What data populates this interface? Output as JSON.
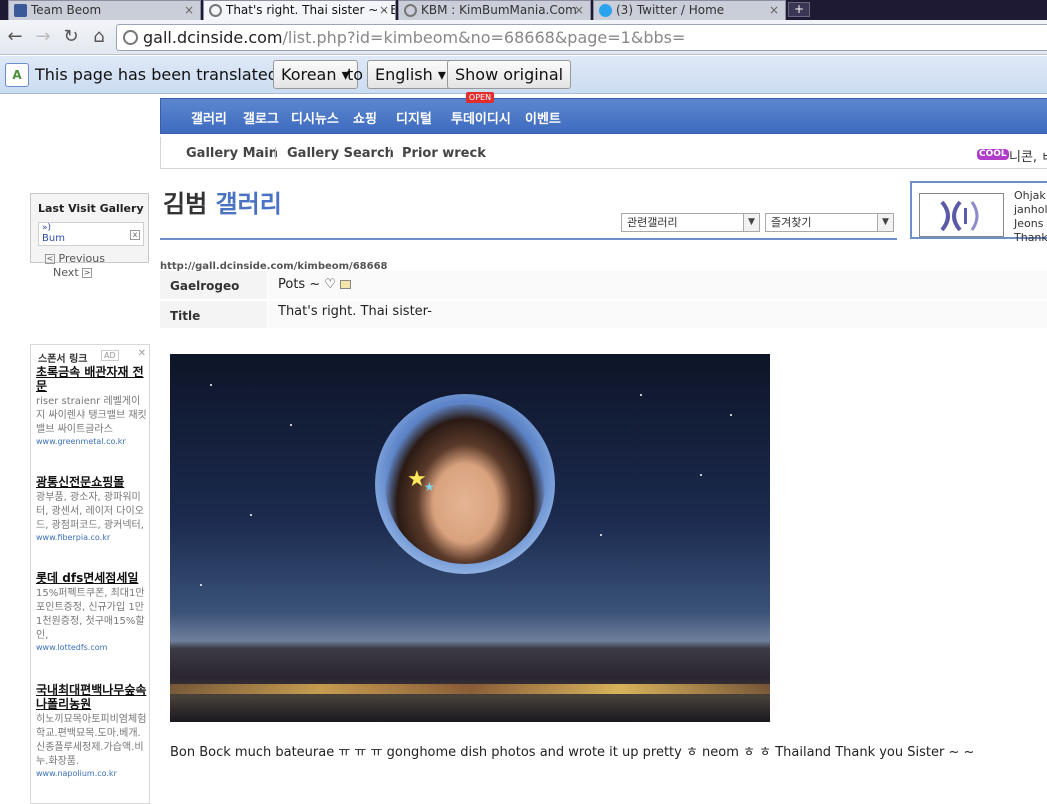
{
  "browser": {
    "tabs": [
      {
        "title": "Team Beom",
        "icon": "facebook-icon",
        "color": "#3b5998"
      },
      {
        "title": "That's right. Thai sister ~ - E",
        "icon": "globe-icon",
        "color": "#7a7a7a"
      },
      {
        "title": "KBM : KimBumMania.Com",
        "icon": "globe-icon",
        "color": "#7a7a7a"
      },
      {
        "title": "(3) Twitter / Home",
        "icon": "twitter-icon",
        "color": "#2aa3ef"
      }
    ],
    "new_tab": "+",
    "url_domain": "gall.dcinside.com",
    "url_path": "/list.php?id=kimbeom&no=68668&page=1&bbs="
  },
  "translate_bar": {
    "text1": "This page has been translated from",
    "from_lang": "Korean",
    "text2": "to",
    "to_lang": "English",
    "show_original": "Show original"
  },
  "gnb": {
    "items": [
      "갤러리",
      "갤로그",
      "디시뉴스",
      "쇼핑",
      "디지털",
      "투데이디시",
      "이벤트"
    ],
    "open_badge": "OPEN"
  },
  "subnav": {
    "items": [
      "Gallery Main",
      "Gallery Search",
      "Prior wreck"
    ],
    "cool_badge": "COOL",
    "cool_text": "니콘, ㅂ"
  },
  "last_visit": {
    "title": "Last Visit Gallery",
    "arrows": "»)",
    "entry": "Bum",
    "prev": "Previous",
    "next": "Next"
  },
  "gallery": {
    "title_main": "김범",
    "title_accent": "갤러리",
    "select1": "관련갤러리",
    "select2": "즐겨찾기",
    "permalink": "http://gall.dcinside.com/kimbeom/68668"
  },
  "ad_right": {
    "lines": [
      "Ohjak",
      "janhol",
      "Jeons",
      "Thank"
    ]
  },
  "post": {
    "author_label": "Gaelrogeo",
    "author_value": "Pots ~ ♡",
    "title_label": "Title",
    "title_value": "That's right. Thai sister-",
    "caption": "Bon Bock much bateurae ㅠ ㅠ ㅠ gonghome dish photos and wrote it up pretty ㅎ neom ㅎ ㅎ Thailand Thank you Sister ~ ~"
  },
  "sponsor": {
    "header": "스폰서 링크",
    "ad_badge": "AD",
    "close": "✕",
    "items": [
      {
        "title": "초록금속 배관자재 전문",
        "desc": "riser straienr 레벨게이지 싸이렌샤 탱크밸브 재킷밸브 싸이트글라스",
        "url": "www.greenmetal.co.kr"
      },
      {
        "title": "광통신전문쇼핑몰",
        "desc": "광부품, 광소자, 광파워미터, 광센서, 레이저 다이오드, 광점퍼코드, 광커넥터,",
        "url": "www.fiberpia.co.kr"
      },
      {
        "title": "롯데 dfs면세점세일",
        "desc": "15%퍼펙트쿠폰, 최대1만포인트증정, 신규가입 1만1천원증정, 첫구매15%할인,",
        "url": "www.lottedfs.com"
      },
      {
        "title": "국내최대편백나무숲속나폴리농원",
        "desc": "히노끼묘목아토피비염체험학교.편백묘목.도마.베개.신종플루세정제.가습액.비누.화장품.",
        "url": "www.napolium.co.kr"
      }
    ]
  }
}
